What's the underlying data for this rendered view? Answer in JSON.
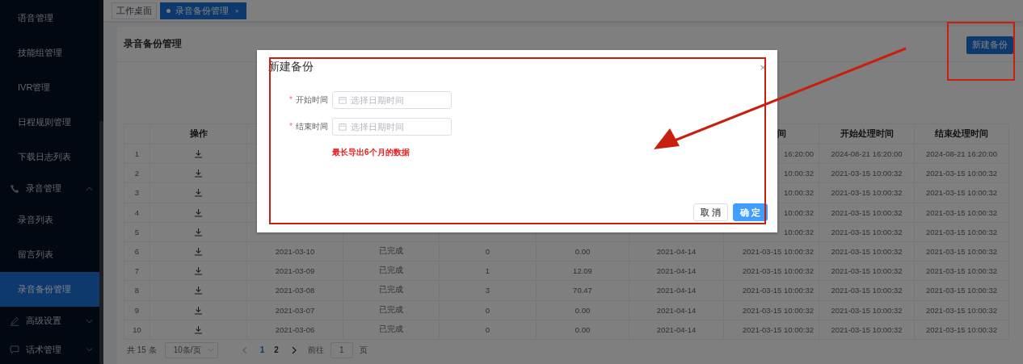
{
  "sidebar": {
    "items": [
      {
        "kind": "item",
        "label": "语音管理",
        "selected": false
      },
      {
        "kind": "item",
        "label": "技能组管理",
        "selected": false
      },
      {
        "kind": "item",
        "label": "IVR管理",
        "selected": false
      },
      {
        "kind": "item",
        "label": "日程规则管理",
        "selected": false
      },
      {
        "kind": "item",
        "label": "下载日志列表",
        "selected": false
      },
      {
        "kind": "group",
        "label": "录音管理",
        "expanded": true
      },
      {
        "kind": "item",
        "label": "录音列表",
        "selected": false
      },
      {
        "kind": "item",
        "label": "留言列表",
        "selected": false
      },
      {
        "kind": "item",
        "label": "录音备份管理",
        "selected": true
      },
      {
        "kind": "group",
        "label": "高级设置",
        "expanded": false
      },
      {
        "kind": "group",
        "label": "话术管理",
        "expanded": false
      }
    ]
  },
  "tabs": [
    {
      "label": "工作桌面",
      "selected": false
    },
    {
      "label": "录音备份管理",
      "selected": true,
      "close": "×"
    }
  ],
  "page": {
    "title": "录音备份管理",
    "new_button": "新建备份"
  },
  "table": {
    "columns": [
      {
        "label": "操作"
      },
      {
        "label": "间"
      },
      {
        "label": "开始处理时间"
      },
      {
        "label": "结束处理时间"
      }
    ],
    "rows": [
      {
        "index": "1",
        "column_8": "16:20:00",
        "column_9": "2024-08-21 16:20:00",
        "column_10": "2024-08-21 16:20:00"
      },
      {
        "index": "2",
        "column_8": "10:00:32",
        "column_9": "2021-03-15 10:00:32",
        "column_10": "2021-03-15 10:00:32"
      },
      {
        "index": "3",
        "column_8": "10:00:32",
        "column_9": "2021-03-15 10:00:32",
        "column_10": "2021-03-15 10:00:32"
      },
      {
        "index": "4",
        "column_8": "10:00:32",
        "column_9": "2021-03-15 10:00:32",
        "column_10": "2021-03-15 10:00:32"
      },
      {
        "index": "5",
        "column_8": "10:00:32",
        "column_9": "2021-03-15 10:00:32",
        "column_10": "2021-03-15 10:00:32"
      },
      {
        "index": "6",
        "column_3": "2021-03-10",
        "column_4": "已完成",
        "column_5": "0",
        "column_6": "0.00",
        "column_7": "2021-04-14",
        "column_8": "2021-03-15 10:00:32",
        "column_9": "2021-03-15 10:00:32",
        "column_10": "2021-03-15 10:00:32"
      },
      {
        "index": "7",
        "column_3": "2021-03-09",
        "column_4": "已完成",
        "column_5": "1",
        "column_6": "12.09",
        "column_7": "2021-04-14",
        "column_8": "2021-03-15 10:00:32",
        "column_9": "2021-03-15 10:00:32",
        "column_10": "2021-03-15 10:00:32"
      },
      {
        "index": "8",
        "column_3": "2021-03-08",
        "column_4": "已完成",
        "column_5": "3",
        "column_6": "70.47",
        "column_7": "2021-04-14",
        "column_8": "2021-03-15 10:00:32",
        "column_9": "2021-03-15 10:00:32",
        "column_10": "2021-03-15 10:00:32"
      },
      {
        "index": "9",
        "column_3": "2021-03-07",
        "column_4": "已完成",
        "column_5": "0",
        "column_6": "0.00",
        "column_7": "2021-04-14",
        "column_8": "2021-03-15 10:00:32",
        "column_9": "2021-03-15 10:00:32",
        "column_10": "2021-03-15 10:00:32"
      },
      {
        "index": "10",
        "column_3": "2021-03-06",
        "column_4": "已完成",
        "column_5": "0",
        "column_6": "0.00",
        "column_7": "2021-04-14",
        "column_8": "2021-03-15 10:00:32",
        "column_9": "2021-03-15 10:00:32",
        "column_10": "2021-03-15 10:00:32"
      }
    ]
  },
  "pagination": {
    "total": "共 15 条",
    "page_size": "10条/页",
    "pages": [
      {
        "label": "1",
        "selected": true
      },
      {
        "label": "2",
        "selected": false
      }
    ],
    "goto_label": "前往",
    "goto_value": "1",
    "goto_suffix": "页"
  },
  "dialog": {
    "title": "新建备份",
    "close": "×",
    "fields": [
      {
        "marker": "*",
        "label": "开始时间",
        "placeholder": "选择日期时间"
      },
      {
        "marker": "*",
        "label": "结束时间",
        "placeholder": "选择日期时间"
      }
    ],
    "hint": "最长导出6个月的数据",
    "buttons": [
      {
        "label": "取 消",
        "kind": "default"
      },
      {
        "label": "确 定",
        "kind": "primary"
      }
    ]
  },
  "annotations": [
    {
      "kind": "box"
    },
    {
      "kind": "box"
    },
    {
      "kind": "arrow"
    }
  ]
}
